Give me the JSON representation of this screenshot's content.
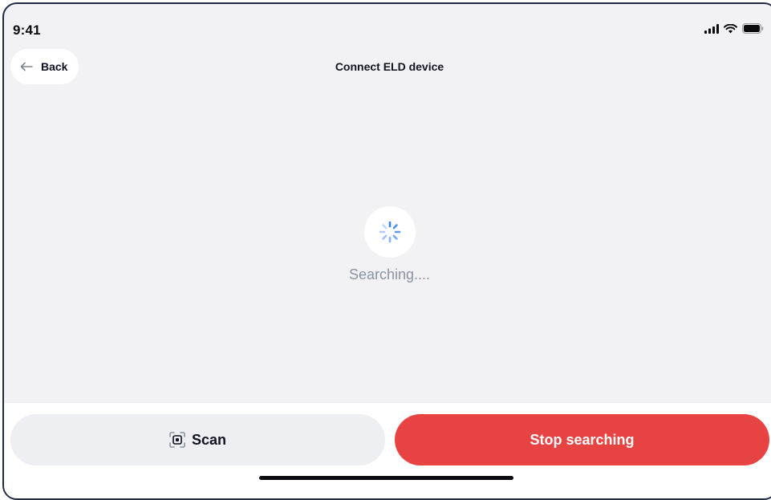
{
  "status_bar": {
    "time": "9:41",
    "icons": [
      "cellular-signal-icon",
      "wifi-icon",
      "battery-icon"
    ]
  },
  "nav": {
    "back_label": "Back",
    "back_icon": "arrow-left-icon",
    "title": "Connect ELD device"
  },
  "main": {
    "spinner_icon": "loading-spinner-icon",
    "status_text": "Searching...."
  },
  "actions": {
    "scan_icon": "scan-frame-icon",
    "scan_label": "Scan",
    "stop_label": "Stop searching"
  },
  "colors": {
    "accent_red": "#e84343",
    "spinner_blue": "#3b82f6",
    "muted_text": "#8a93a6"
  }
}
